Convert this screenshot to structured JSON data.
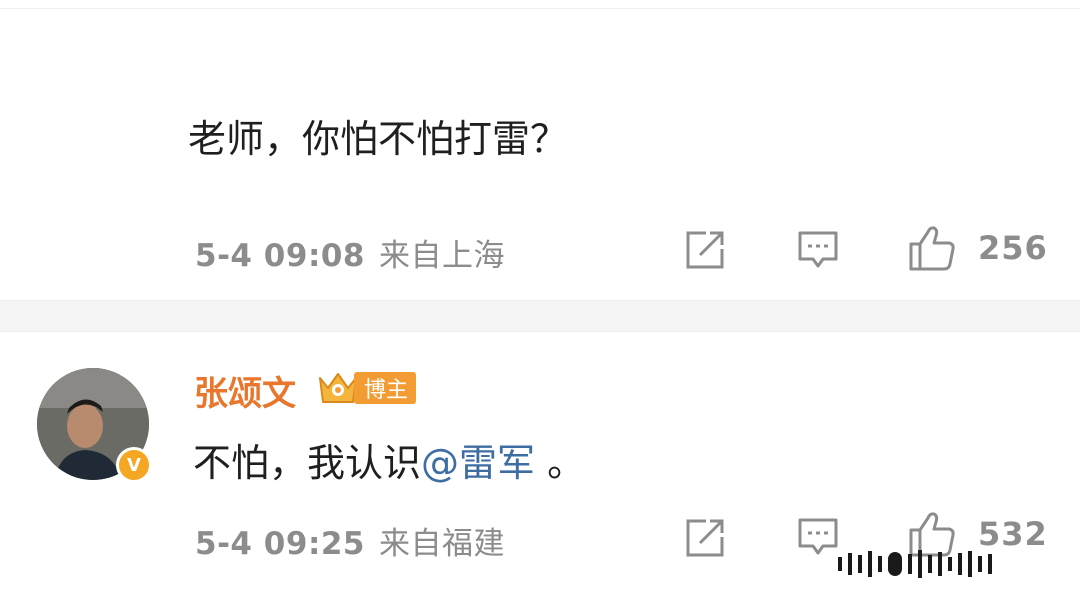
{
  "comments": [
    {
      "text": "老师，你怕不怕打雷？",
      "time": "5-4 09:08",
      "location": "来自上海",
      "like_count": "256"
    },
    {
      "author": "张颂文",
      "badge": "博主",
      "text_before": "不怕，我认识",
      "mention": "@雷军",
      "text_after": " 。",
      "time": "5-4 09:25",
      "location": "来自福建",
      "like_count": "532",
      "avatar_verified": "V"
    }
  ],
  "colors": {
    "username": "#e8762c",
    "mention": "#3d6da3",
    "meta_gray": "#8c8c8c",
    "badge_orange": "#f39c33"
  },
  "icons": [
    "share-icon",
    "comment-icon",
    "like-icon",
    "crown-icon",
    "verified-icon"
  ]
}
